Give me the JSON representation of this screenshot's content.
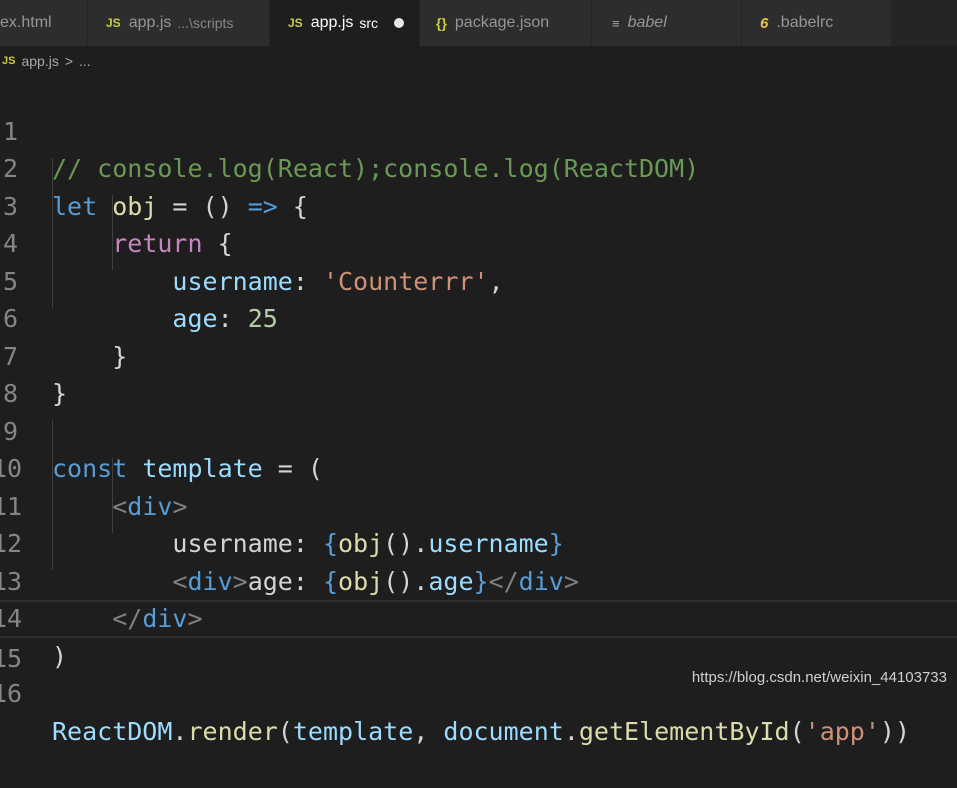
{
  "tabs": [
    {
      "label": "ex.html",
      "description": "",
      "icon": "html-file-icon",
      "active": false
    },
    {
      "label": "app.js",
      "description": "...\\scripts",
      "icon": "js-file-icon",
      "active": false
    },
    {
      "label": "app.js",
      "description": "src",
      "icon": "js-file-icon",
      "active": true,
      "dirty": true
    },
    {
      "label": "package.json",
      "description": "",
      "icon": "json-file-icon",
      "active": false
    },
    {
      "label": "babel",
      "description": "",
      "icon": "file-lines-icon",
      "active": false
    },
    {
      "label": ".babelrc",
      "description": "",
      "icon": "babelrc-file-icon",
      "active": false
    }
  ],
  "icons": {
    "js": "JS",
    "json": "{}",
    "babel": "≡",
    "babelrc": "6"
  },
  "breadcrumb": {
    "file": "app.js",
    "separator": ">",
    "more": "..."
  },
  "line_numbers": [
    "1",
    "2",
    "3",
    "4",
    "5",
    "6",
    "7",
    "8",
    "9",
    "10",
    "11",
    "12",
    "13",
    "14",
    "15",
    "16"
  ],
  "code": {
    "l1": {
      "comment": "// console.log(React);console.log(ReactDOM)"
    },
    "l2": {
      "kw": "let",
      "name": " obj",
      "rest": " = () ",
      "arrow": "=>",
      "brace": " {"
    },
    "l3": {
      "indent": "    ",
      "kw": "return",
      "brace": " {"
    },
    "l4": {
      "indent": "        ",
      "key": "username",
      "colon": ": ",
      "str": "'Counterrr'",
      "comma": ","
    },
    "l5": {
      "indent": "        ",
      "key": "age",
      "colon": ": ",
      "num": "25"
    },
    "l6": {
      "indent": "    ",
      "brace": "}"
    },
    "l7": {
      "brace": "}"
    },
    "l9": {
      "kw": "const",
      "name": " template",
      "rest": " = ("
    },
    "l10": {
      "indent": "    ",
      "lt": "<",
      "tag": "div",
      "gt": ">"
    },
    "l11": {
      "indent": "        ",
      "text": "username: ",
      "ob": "{",
      "obj": "obj",
      "call": "().",
      "prop": "username",
      "cb": "}"
    },
    "l12": {
      "indent": "        ",
      "lt": "<",
      "tag": "div",
      "gt": ">",
      "text": "age: ",
      "ob": "{",
      "obj": "obj",
      "call": "().",
      "prop": "age",
      "cb": "}",
      "clt": "</",
      "ctag": "div",
      "cgt": ">"
    },
    "l13": {
      "indent": "    ",
      "clt": "</",
      "ctag": "div",
      "cgt": ">"
    },
    "l14": {
      "paren": ")"
    },
    "l16": {
      "obj": "ReactDOM",
      "dot": ".",
      "fn": "render",
      "open": "(",
      "arg1": "template",
      "comma": ", ",
      "doc": "document",
      "dot2": ".",
      "fn2": "getElementById",
      "open2": "(",
      "str": "'app'",
      "close": "))"
    }
  },
  "watermark": "https://blog.csdn.net/weixin_44103733"
}
